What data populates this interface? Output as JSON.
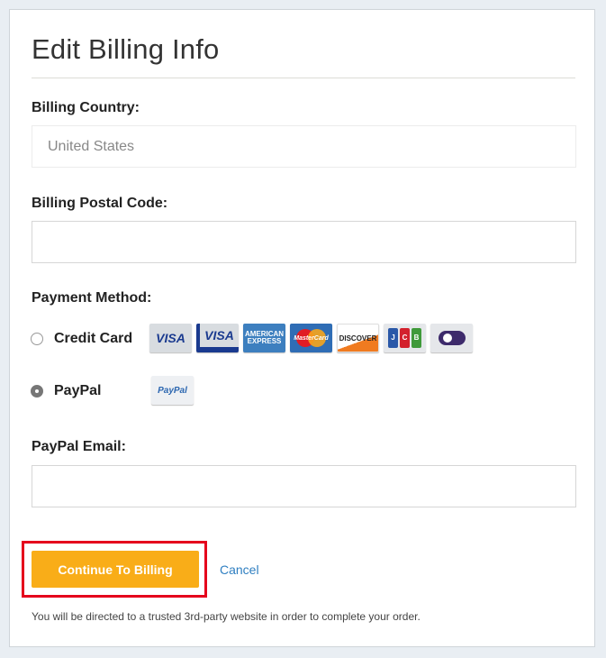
{
  "form": {
    "title": "Edit Billing Info",
    "country": {
      "label": "Billing Country:",
      "value": "United States"
    },
    "postal": {
      "label": "Billing Postal Code:",
      "value": ""
    },
    "payment": {
      "label": "Payment Method:",
      "options": [
        {
          "label": "Credit Card",
          "selected": false
        },
        {
          "label": "PayPal",
          "selected": true
        }
      ],
      "card_logos": [
        "VISA",
        "VISA",
        "AMERICAN EXPRESS",
        "MasterCard",
        "DISCOVER",
        "JCB",
        "Diners Club"
      ],
      "card_logo_texts": {
        "visa": "VISA",
        "visa_electron": "VISA",
        "amex": "AMERICAN EXPRESS",
        "mastercard": "MasterCard",
        "discover": "DISCOVER",
        "jcb": [
          "J",
          "C",
          "B"
        ]
      },
      "paypal_logo": "PayPal"
    },
    "paypal_email": {
      "label": "PayPal Email:",
      "value": ""
    },
    "continue_label": "Continue To Billing",
    "cancel_label": "Cancel",
    "note": "You will be directed to a trusted 3rd-party website in order to complete your order."
  },
  "colors": {
    "accent": "#f9ad18",
    "link": "#2f7fc1",
    "highlight": "#e5001c"
  }
}
